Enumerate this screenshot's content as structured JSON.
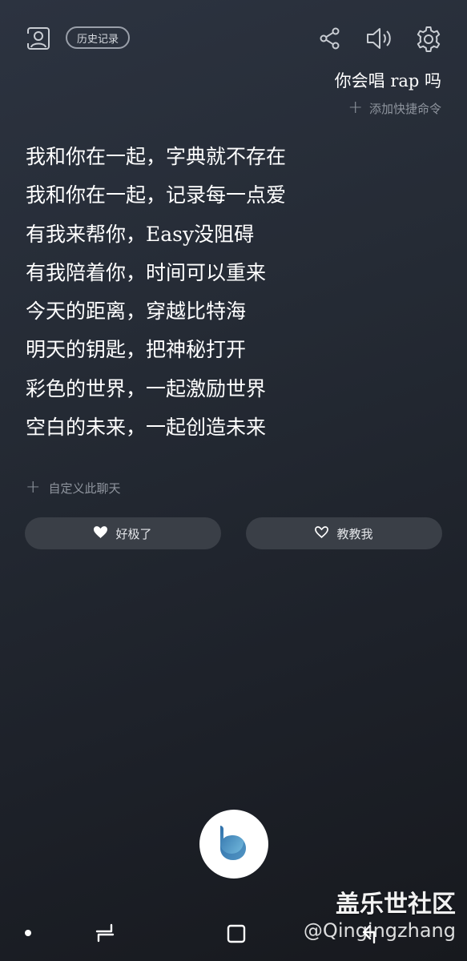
{
  "header": {
    "history_label": "历史记录",
    "profile_icon": "profile-icon",
    "share_icon": "share-icon",
    "volume_icon": "volume-icon",
    "settings_icon": "gear-icon"
  },
  "conversation": {
    "query": "你会唱 rap 吗",
    "add_shortcut_label": "添加快捷命令",
    "lyrics": [
      "我和你在一起，字典就不存在",
      "我和你在一起，记录每一点爱",
      "有我来帮你，Easy没阻碍",
      "有我陪着你，时间可以重来",
      "今天的距离，穿越比特海",
      "明天的钥匙，把神秘打开",
      "彩色的世界，一起激励世界",
      "空白的未来，一起创造未来"
    ],
    "customize_label": "自定义此聊天"
  },
  "feedback": {
    "like_label": "好极了",
    "teach_label": "教教我"
  },
  "bixby": {
    "icon": "bixby-logo-icon",
    "accent_colors": [
      "#2d6ea8",
      "#7fc6e6"
    ]
  },
  "watermark": {
    "site": "盖乐世社区",
    "user": "@Qingingzhang"
  },
  "colors": {
    "background_top": "#2c3340",
    "background_bottom": "#17191e",
    "button_bg": "#3a3f47",
    "muted_text": "#8f959e"
  }
}
